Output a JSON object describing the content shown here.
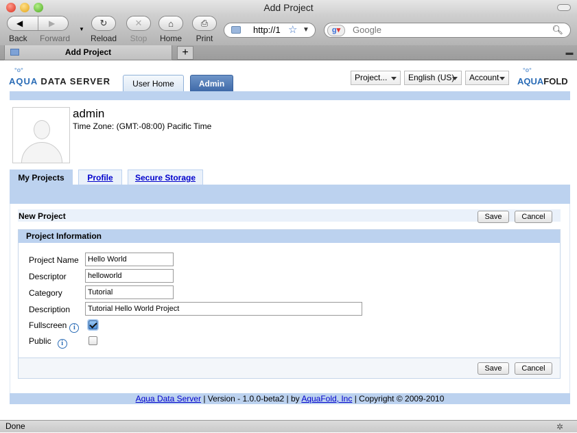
{
  "window": {
    "title": "Add Project"
  },
  "toolbar": {
    "back": "Back",
    "forward": "Forward",
    "reload": "Reload",
    "stop": "Stop",
    "home": "Home",
    "print": "Print",
    "url": "http://1",
    "search_placeholder": "Google"
  },
  "browser_tab": {
    "label": "Add Project"
  },
  "app": {
    "logo_left_brand": "AQUA",
    "logo_left_rest": "DATA SERVER",
    "logo_right_brand": "AQUA",
    "logo_right_rest": "FOLD",
    "tabs": [
      "User Home",
      "Admin"
    ],
    "menus": [
      "Project...",
      "English (US)",
      "Account"
    ]
  },
  "user": {
    "name": "admin",
    "timezone": "Time Zone: (GMT:-08:00) Pacific Time"
  },
  "profile_tabs": [
    "My Projects",
    "Profile",
    "Secure Storage"
  ],
  "form": {
    "title": "New Project",
    "save": "Save",
    "cancel": "Cancel",
    "section": "Project Information",
    "labels": {
      "name": "Project Name",
      "descriptor": "Descriptor",
      "category": "Category",
      "description": "Description",
      "fullscreen": "Fullscreen",
      "public": "Public"
    },
    "values": {
      "name": "Hello World",
      "descriptor": "helloworld",
      "category": "Tutorial",
      "description": "Tutorial Hello World Project",
      "fullscreen": true,
      "public": false
    },
    "info_icon": "i"
  },
  "footer": {
    "link1": "Aqua Data Server",
    "version": "| Version - 1.0.0-beta2 | by",
    "link2": "AquaFold, Inc",
    "copyright": "| Copyright © 2009-2010"
  },
  "status": {
    "text": "Done"
  }
}
